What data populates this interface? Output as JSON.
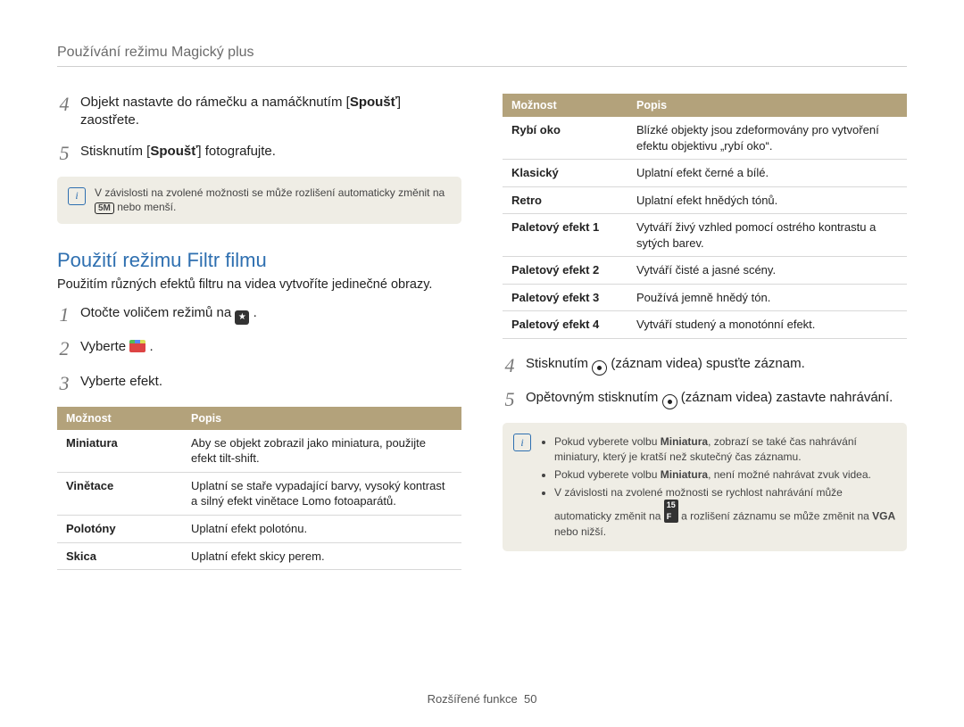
{
  "header": {
    "title": "Používání režimu Magický plus"
  },
  "left": {
    "steps_a": [
      {
        "n": "4",
        "pre": "Objekt nastavte do rámečku a namáčknutím [",
        "b": "Spoušť",
        "post": "] zaostřete."
      },
      {
        "n": "5",
        "pre": "Stisknutím [",
        "b": "Spoušť",
        "post": "] fotografujte."
      }
    ],
    "note1_pre": "V závislosti na zvolené možnosti se může rozlišení automaticky změnit na ",
    "note1_badge": "5M",
    "note1_post": " nebo menší.",
    "section_title": "Použití režimu Filtr filmu",
    "lead": "Použitím různých efektů filtru na videa vytvoříte jedinečné obrazy.",
    "steps_b": [
      {
        "n": "1",
        "text": "Otočte voličem režimů na ",
        "icon": "dial"
      },
      {
        "n": "2",
        "text": "Vyberte ",
        "icon": "clip"
      },
      {
        "n": "3",
        "text": "Vyberte efekt."
      }
    ],
    "table": {
      "headers": {
        "option": "Možnost",
        "desc": "Popis"
      },
      "rows": [
        {
          "k": "Miniatura",
          "v": "Aby se objekt zobrazil jako miniatura, použijte efekt tilt-shift."
        },
        {
          "k": "Vinětace",
          "v": "Uplatní se staře vypadající barvy, vysoký kontrast a silný efekt vinětace Lomo fotoaparátů."
        },
        {
          "k": "Polotóny",
          "v": "Uplatní efekt polotónu."
        },
        {
          "k": "Skica",
          "v": "Uplatní efekt skicy perem."
        }
      ]
    }
  },
  "right": {
    "table": {
      "headers": {
        "option": "Možnost",
        "desc": "Popis"
      },
      "rows": [
        {
          "k": "Rybí oko",
          "v": "Blízké objekty jsou zdeformovány pro vytvoření efektu objektivu „rybí oko“."
        },
        {
          "k": "Klasický",
          "v": "Uplatní efekt černé a bílé."
        },
        {
          "k": "Retro",
          "v": "Uplatní efekt hnědých tónů."
        },
        {
          "k": "Paletový efekt 1",
          "v": "Vytváří živý vzhled pomocí ostrého kontrastu a sytých barev."
        },
        {
          "k": "Paletový efekt 2",
          "v": "Vytváří čisté a jasné scény."
        },
        {
          "k": "Paletový efekt 3",
          "v": "Používá jemně hnědý tón."
        },
        {
          "k": "Paletový efekt 4",
          "v": "Vytváří studený a monotónní efekt."
        }
      ]
    },
    "steps": [
      {
        "n": "4",
        "pre": "Stisknutím ",
        "mid": " (záznam videa) spusťte záznam."
      },
      {
        "n": "5",
        "pre": "Opětovným stisknutím ",
        "mid": " (záznam videa) zastavte nahrávání."
      }
    ],
    "note2": {
      "li1_pre": "Pokud vyberete volbu ",
      "li1_b": "Miniatura",
      "li1_post": ", zobrazí se také čas nahrávání miniatury, který je kratší než skutečný čas záznamu.",
      "li2_pre": "Pokud vyberete volbu ",
      "li2_b": "Miniatura",
      "li2_post": ", není možné nahrávat zvuk videa.",
      "li3_pre": "V závislosti na zvolené možnosti se rychlost nahrávání může automaticky změnit na ",
      "li3_mid": " a rozlišení záznamu se může změnit na ",
      "li3_vga": "VGA",
      "li3_post": " nebo nižší."
    }
  },
  "footer": {
    "section": "Rozšířené funkce",
    "page": "50"
  }
}
